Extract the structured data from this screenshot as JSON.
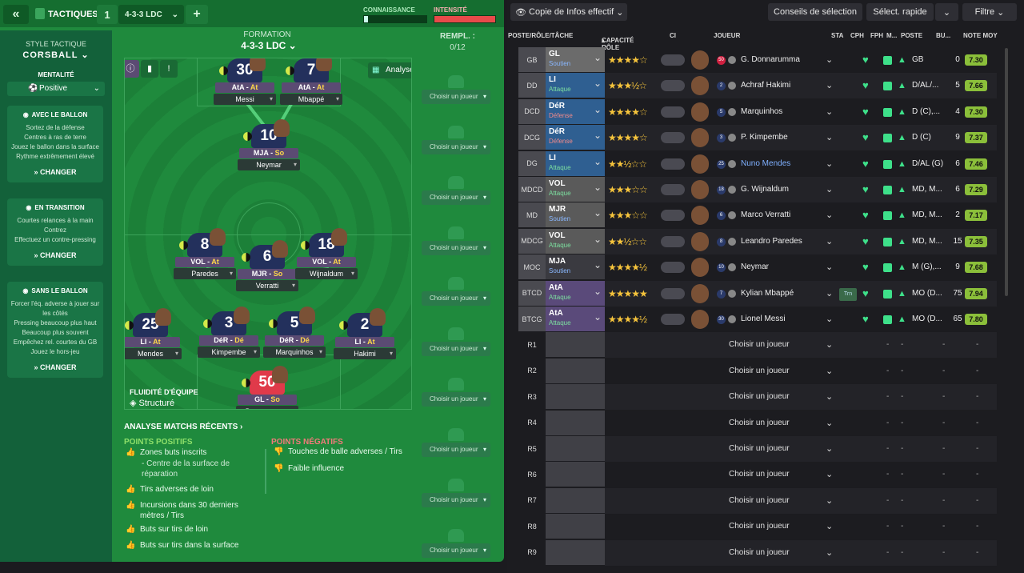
{
  "topbar": {
    "back": "«",
    "title": "TACTIQUES",
    "slot": "1",
    "formation_name": "4-3-3 LDC",
    "add": "+",
    "meter1": "CONNAISSANCE",
    "meter2": "INTENSITÉ"
  },
  "sidebar": {
    "style_label": "STYLE TACTIQUE",
    "style_value": "CORSBALL",
    "mentality_label": "MENTALITÉ",
    "mentality_value": "Positive",
    "cards": [
      {
        "title": "AVEC LE BALLON",
        "lines": [
          "Sortez de la défense",
          "Centres à ras de terre",
          "Jouez le ballon dans la surface",
          "Rythme extrêmement élevé"
        ],
        "change": "CHANGER"
      },
      {
        "title": "EN TRANSITION",
        "lines": [
          "Courtes relances à la main",
          "Contrez",
          "Effectuez un contre-pressing"
        ],
        "change": "CHANGER"
      },
      {
        "title": "SANS LE BALLON",
        "lines": [
          "Forcer l'éq. adverse à jouer sur les côtés",
          "Pressing beaucoup plus haut",
          "Beaucoup plus souvent",
          "Empêchez rel. courtes du GB",
          "Jouez le hors-jeu"
        ],
        "change": "CHANGER"
      }
    ]
  },
  "formation": {
    "label": "FORMATION",
    "value": "4-3-3 LDC",
    "analyse": "Analyse",
    "fluid_label": "FLUIDITÉ D'ÉQUIPE",
    "fluid_value": "Structuré"
  },
  "pitch_players": [
    {
      "num": "30",
      "role": "AtA",
      "duty": "At",
      "name": "Messi"
    },
    {
      "num": "7",
      "role": "AtA",
      "duty": "At",
      "name": "Mbappé"
    },
    {
      "num": "10",
      "role": "MJA",
      "duty": "So",
      "name": "Neymar"
    },
    {
      "num": "8",
      "role": "VOL",
      "duty": "At",
      "name": "Paredes"
    },
    {
      "num": "6",
      "role": "MJR",
      "duty": "So",
      "name": "Verratti"
    },
    {
      "num": "18",
      "role": "VOL",
      "duty": "At",
      "name": "Wijnaldum"
    },
    {
      "num": "25",
      "role": "LI",
      "duty": "At",
      "name": "Mendes"
    },
    {
      "num": "3",
      "role": "DéR",
      "duty": "Dé",
      "name": "Kimpembe"
    },
    {
      "num": "5",
      "role": "DéR",
      "duty": "Dé",
      "name": "Marquinhos"
    },
    {
      "num": "2",
      "role": "LI",
      "duty": "At",
      "name": "Hakimi"
    },
    {
      "num": "50",
      "role": "GL",
      "duty": "So",
      "name": "Donnarumma"
    }
  ],
  "subs": {
    "label": "REMPL. :",
    "count": "0/12",
    "choose": "Choisir un joueur"
  },
  "analysis": {
    "title": "ANALYSE MATCHS RÉCENTS ›",
    "pos_label": "POINTS POSITIFS",
    "neg_label": "POINTS NÉGATIFS",
    "positives": [
      "Zones buts inscrits",
      "- Centre de la surface de réparation",
      "Tirs adverses de loin",
      "Incursions dans 30 derniers mètres / Tirs",
      "Buts sur tirs de loin",
      "Buts sur tirs dans la surface"
    ],
    "negatives": [
      "Touches de balle adverses / Tirs",
      "Faible influence"
    ]
  },
  "right_toolbar": {
    "view": "Copie de Infos effectif",
    "advice": "Conseils de sélection",
    "quick": "Sélect. rapide",
    "filter": "Filtre"
  },
  "columns": [
    "POSTE/RÔLE/TÂCHE",
    "CAPACITÉ RÔLE",
    "CI",
    "JOUEUR",
    "STA",
    "CPH",
    "FPH",
    "M...",
    "POSTE",
    "BU...",
    "NOTE MOY"
  ],
  "rows": [
    {
      "pos": "GB",
      "role": "GL",
      "duty": "Soutien",
      "stars": "★★★★☆",
      "num": "50",
      "name": "G. Donnarumma",
      "poste": "GB",
      "bu": "0",
      "note": "7.30",
      "color": "#6b6b6b"
    },
    {
      "pos": "DD",
      "role": "LI",
      "duty": "Attaque",
      "stars": "★★★½☆",
      "num": "2",
      "name": "Achraf Hakimi",
      "poste": "D/AL/...",
      "bu": "5",
      "note": "7.66",
      "color": "#2f5f91"
    },
    {
      "pos": "DCD",
      "role": "DéR",
      "duty": "Défense",
      "stars": "★★★★☆",
      "num": "5",
      "name": "Marquinhos",
      "poste": "D (C),...",
      "bu": "4",
      "note": "7.30",
      "color": "#2f5f91"
    },
    {
      "pos": "DCG",
      "role": "DéR",
      "duty": "Défense",
      "stars": "★★★★☆",
      "num": "3",
      "name": "P. Kimpembe",
      "poste": "D (C)",
      "bu": "9",
      "note": "7.37",
      "color": "#2f5f91"
    },
    {
      "pos": "DG",
      "role": "LI",
      "duty": "Attaque",
      "stars": "★★½☆☆",
      "num": "25",
      "name": "Nuno Mendes",
      "poste": "D/AL (G)",
      "bu": "6",
      "note": "7.46",
      "color": "#2f5f91"
    },
    {
      "pos": "MDCD",
      "role": "VOL",
      "duty": "Attaque",
      "stars": "★★★☆☆",
      "num": "18",
      "name": "G. Wijnaldum",
      "poste": "MD, M...",
      "bu": "6",
      "note": "7.29",
      "color": "#5a5a5a"
    },
    {
      "pos": "MD",
      "role": "MJR",
      "duty": "Soutien",
      "stars": "★★★☆☆",
      "num": "6",
      "name": "Marco Verratti",
      "poste": "MD, M...",
      "bu": "2",
      "note": "7.17",
      "color": "#5a5a5a"
    },
    {
      "pos": "MDCG",
      "role": "VOL",
      "duty": "Attaque",
      "stars": "★★½☆☆",
      "num": "8",
      "name": "Leandro Paredes",
      "poste": "MD, M...",
      "bu": "15",
      "note": "7.35",
      "color": "#5a5a5a"
    },
    {
      "pos": "MOC",
      "role": "MJA",
      "duty": "Soutien",
      "stars": "★★★★½",
      "num": "10",
      "name": "Neymar",
      "poste": "M (G),...",
      "bu": "9",
      "note": "7.68",
      "color": "#3a3a40"
    },
    {
      "pos": "BTCD",
      "role": "AtA",
      "duty": "Attaque",
      "stars": "★★★★★",
      "num": "7",
      "name": "Kylian Mbappé",
      "poste": "MO (D...",
      "bu": "75",
      "note": "7.94",
      "color": "#5a4a7a",
      "sta": "Trn"
    },
    {
      "pos": "BTCG",
      "role": "AtA",
      "duty": "Attaque",
      "stars": "★★★★½",
      "num": "30",
      "name": "Lionel Messi",
      "poste": "MO (D...",
      "bu": "65",
      "note": "7.80",
      "color": "#5a4a7a"
    }
  ],
  "reserves": [
    "R1",
    "R2",
    "R3",
    "R4",
    "R5",
    "R6",
    "R7",
    "R8",
    "R9"
  ],
  "reserve_choose": "Choisir un joueur",
  "dash": "-",
  "colors": {
    "pitch": "#1f8a3d",
    "accent_green": "#3ee08a",
    "note_green": "#8bbf3a"
  }
}
